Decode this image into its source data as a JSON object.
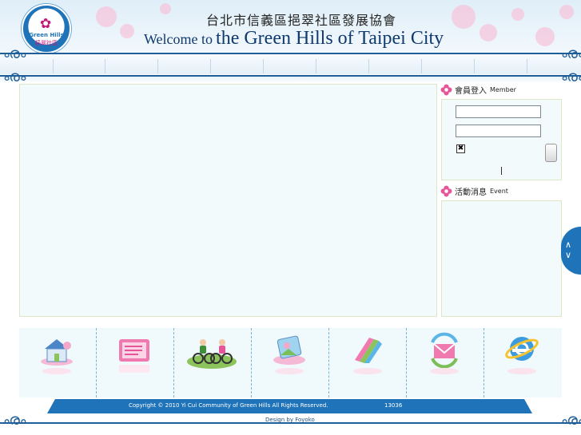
{
  "header": {
    "title_zh": "台北市信義區挹翠社區發展協會",
    "title_en_prefix": "Welcome to",
    "title_en_main": "the Green Hills of Taipei City",
    "logo_text_en": "Green Hills",
    "logo_text_zh": "挹翠社區"
  },
  "sidebar": {
    "member": {
      "title_zh": "會員登入",
      "title_en": "Member"
    },
    "event": {
      "title_zh": "活動消息",
      "title_en": "Event"
    }
  },
  "icon_bar": {
    "items": [
      {
        "icon": "house-icon"
      },
      {
        "icon": "notice-board-icon"
      },
      {
        "icon": "cycling-icon"
      },
      {
        "icon": "photo-frame-icon"
      },
      {
        "icon": "books-icon"
      },
      {
        "icon": "mail-icon"
      },
      {
        "icon": "internet-explorer-icon"
      }
    ]
  },
  "footer": {
    "copyright": "Copyright © 2010 Yi Cui Community of Green Hills All Rights Reserved.",
    "counter": "13036",
    "designer": "Design by Foyoko"
  },
  "colors": {
    "brand_blue": "#1f73b8",
    "accent_pink": "#e6559a",
    "panel_bg": "#f3fafc"
  }
}
